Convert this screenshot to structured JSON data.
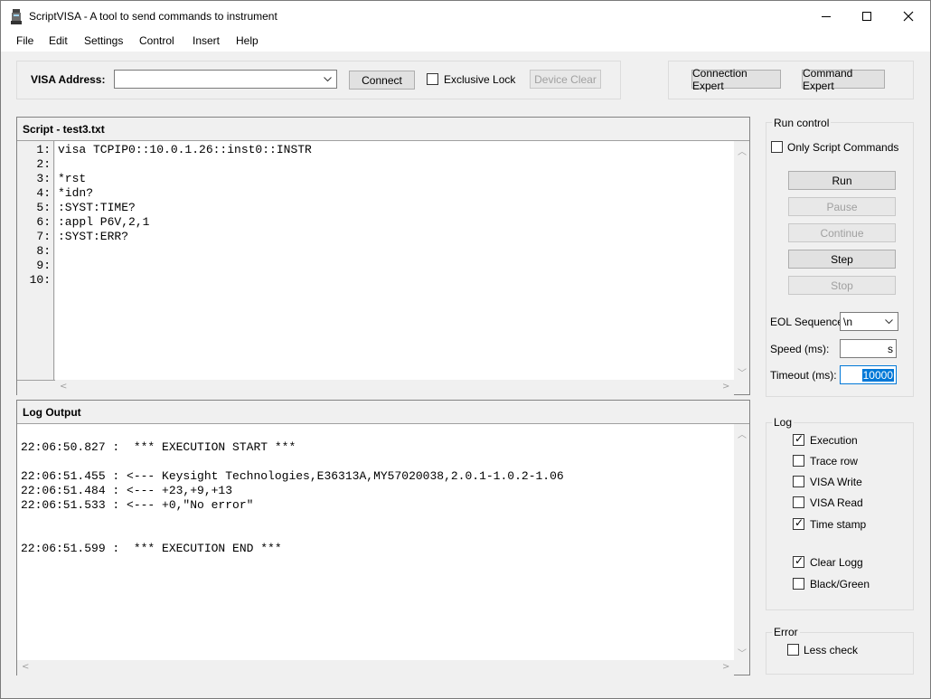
{
  "window": {
    "title": "ScriptVISA - A tool to send commands to instrument",
    "minimize_icon": "minimize-icon",
    "maximize_icon": "maximize-icon",
    "close_icon": "close-icon"
  },
  "menu": [
    "File",
    "Edit",
    "Settings",
    "Control",
    "Insert",
    "Help"
  ],
  "toolbar": {
    "visa_label": "VISA Address:",
    "visa_value": "",
    "connect": "Connect",
    "exclusive_lock": "Exclusive Lock",
    "exclusive_lock_checked": false,
    "device_clear": "Device Clear",
    "connection_expert": "Connection Expert",
    "command_expert": "Command Expert"
  },
  "script": {
    "title": "Script - test3.txt",
    "line_numbers": [
      "1:",
      "2:",
      "3:",
      "4:",
      "5:",
      "6:",
      "7:",
      "8:",
      "9:",
      "10:"
    ],
    "lines": [
      "visa TCPIP0::10.0.1.26::inst0::INSTR",
      "",
      "*rst",
      "*idn?",
      ":SYST:TIME?",
      ":appl P6V,2,1",
      ":SYST:ERR?",
      "",
      "",
      ""
    ]
  },
  "log": {
    "title": "Log Output",
    "lines": [
      "",
      "22:06:50.827 :  *** EXECUTION START ***",
      "",
      "22:06:51.455 : <--- Keysight Technologies,E36313A,MY57020038,2.0.1-1.0.2-1.06",
      "22:06:51.484 : <--- +23,+9,+13",
      "22:06:51.533 : <--- +0,\"No error\"",
      "",
      "",
      "22:06:51.599 :  *** EXECUTION END ***"
    ]
  },
  "run_control": {
    "title": "Run control",
    "only_script": "Only Script Commands",
    "only_script_checked": false,
    "run": "Run",
    "pause": "Pause",
    "continue": "Continue",
    "step": "Step",
    "stop": "Stop",
    "eol_label": "EOL Sequence:",
    "eol_value": "\\n",
    "speed_label": "Speed (ms):",
    "speed_value": "s",
    "timeout_label": "Timeout (ms):",
    "timeout_value": "10000"
  },
  "log_options": {
    "title": "Log",
    "items": [
      {
        "label": "Execution",
        "checked": true
      },
      {
        "label": "Trace row",
        "checked": false
      },
      {
        "label": "VISA Write",
        "checked": false
      },
      {
        "label": "VISA Read",
        "checked": false
      },
      {
        "label": "Time stamp",
        "checked": true
      },
      {
        "label": "Clear Logg",
        "checked": true
      },
      {
        "label": "Black/Green",
        "checked": false
      }
    ]
  },
  "error_group": {
    "title": "Error",
    "less_check": "Less check",
    "less_check_checked": false
  },
  "colors": {
    "selection": "#0078d7",
    "window_bg": "#f0f0f0"
  }
}
